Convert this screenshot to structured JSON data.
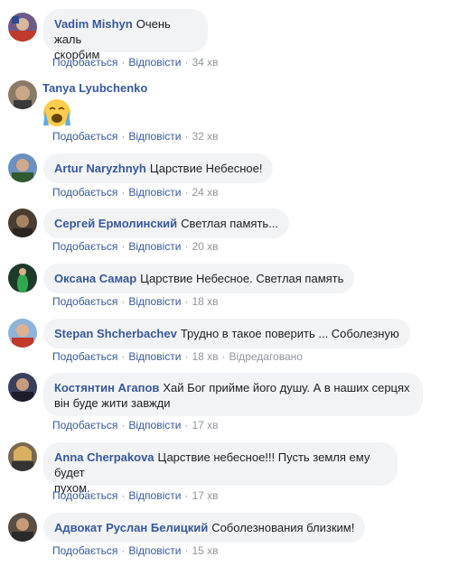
{
  "comments": [
    {
      "author": "Vadim Mishyn",
      "text": "Очень жаль",
      "text2": "скорбим",
      "like": "Подобається",
      "reply": "Відповісти",
      "time": "34 хв",
      "avatar_color": "#6e5a8a"
    },
    {
      "author": "Tanya Lyubchenko",
      "text": "",
      "emoji": "crying-face",
      "like": "Подобається",
      "reply": "Відповісти",
      "time": "32 хв",
      "avatar_color": "#8a7a68"
    },
    {
      "author": "Artur Naryzhnyh",
      "text": "Царствие Небесное!",
      "like": "Подобається",
      "reply": "Відповісти",
      "time": "24 хв",
      "avatar_color": "#3a5a3a"
    },
    {
      "author": "Сергей Ермолинский",
      "text": "Светлая память...",
      "like": "Подобається",
      "reply": "Відповісти",
      "time": "20 хв",
      "avatar_color": "#4a3e32"
    },
    {
      "author": "Оксана Самар",
      "text": "Царствие Небесное. Светлая память",
      "like": "Подобається",
      "reply": "Відповісти",
      "time": "18 хв",
      "avatar_color": "#2d6b3c"
    },
    {
      "author": "Stepan Shcherbachev",
      "text": "Трудно в такое поверить ... Соболезную",
      "like": "Подобається",
      "reply": "Відповісти",
      "time": "18 хв",
      "edited": "Відредаговано",
      "avatar_color": "#b0403a"
    },
    {
      "author": "Костянтин Агапов",
      "text": "Хай Бог прийме його душу. А в наших серцях",
      "text2": "він буде жити завжди",
      "like": "Подобається",
      "reply": "Відповісти",
      "time": "17 хв",
      "avatar_color": "#3a3f5c"
    },
    {
      "author": "Anna Cherpakova",
      "text": "Царствие небесное!!! Пусть земля ему будет",
      "text2": "пухом.",
      "like": "Подобається",
      "reply": "Відповісти",
      "time": "17 хв",
      "avatar_color": "#7a6a52"
    },
    {
      "author": "Адвокат Руслан Белицкий",
      "text": "Соболезнования близким!",
      "like": "Подобається",
      "reply": "Відповісти",
      "time": "15 хв",
      "avatar_color": "#5a4e44"
    }
  ]
}
